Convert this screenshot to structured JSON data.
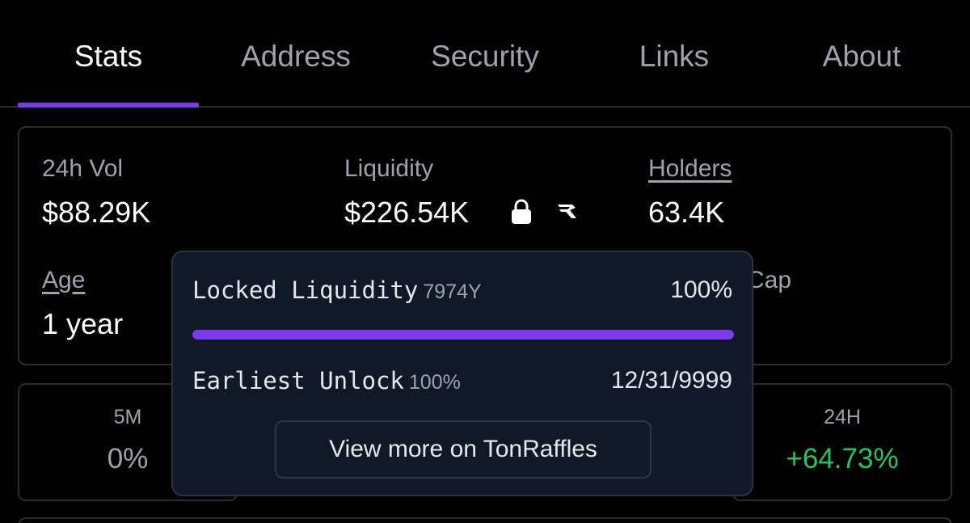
{
  "tabs": [
    {
      "label": "Stats",
      "active": true
    },
    {
      "label": "Address",
      "active": false
    },
    {
      "label": "Security",
      "active": false
    },
    {
      "label": "Links",
      "active": false
    },
    {
      "label": "About",
      "active": false
    }
  ],
  "stats": {
    "vol_label": "24h Vol",
    "vol_value": "$88.29K",
    "liquidity_label": "Liquidity",
    "liquidity_value": "$226.54K",
    "holders_label": "Holders",
    "holders_value": "63.4K",
    "age_label": "Age",
    "age_value": "1 year",
    "mcap_label_partial": "Cap"
  },
  "changes": {
    "m5_label": "5M",
    "m5_value": "0%",
    "h24_label": "24H",
    "h24_value": "+64.73%"
  },
  "popover": {
    "locked_label": "Locked Liquidity",
    "locked_duration": "7974Y",
    "locked_percent": "100%",
    "locked_fraction": 1.0,
    "unlock_label": "Earliest Unlock",
    "unlock_percent": "100%",
    "unlock_date": "12/31/9999",
    "button_label": "View more on TonRaffles"
  },
  "icons": {
    "lock": "lock-icon",
    "tonraffles": "tonraffles-logo-icon"
  },
  "colors": {
    "accent": "#7c3aed",
    "positive": "#22c55e",
    "muted": "#9ca3af",
    "background": "#000000",
    "popover_bg": "#111827"
  }
}
